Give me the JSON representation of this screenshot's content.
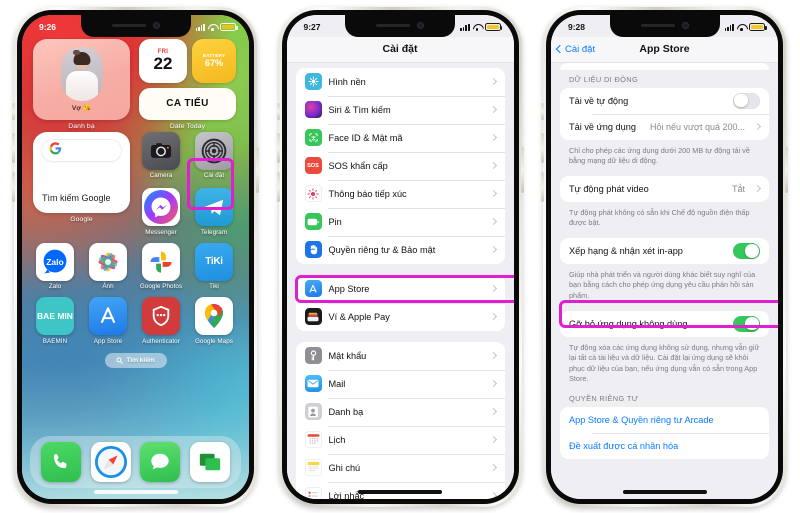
{
  "phone1": {
    "status": {
      "time": "9:26",
      "battery_level": "67",
      "battery_color": "#f5c518"
    },
    "widgets": {
      "contacts": {
        "name": "Vợ 😘",
        "label": "Danh bạ"
      },
      "date": {
        "dow": "FRI",
        "day": "22",
        "battery_title": "BATTERY",
        "battery_value": "67%",
        "ca_text": "CA TIẾU",
        "label": "Date Today"
      },
      "google": {
        "logo": "G",
        "text": "Tìm kiếm Google",
        "label": "Google"
      }
    },
    "apps_row1": [
      {
        "name": "camera-app",
        "label": "Camera"
      },
      {
        "name": "settings-app",
        "label": "Cài đặt"
      }
    ],
    "apps_row2": [
      {
        "name": "messenger-app",
        "label": "Messenger"
      },
      {
        "name": "telegram-app",
        "label": "Telegram"
      }
    ],
    "apps_row3": [
      {
        "name": "zalo-app",
        "label": "Zalo",
        "glyph": "Zalo"
      },
      {
        "name": "photos-app",
        "label": "Ảnh",
        "glyph": ""
      },
      {
        "name": "google-photos-app",
        "label": "Google Photos",
        "glyph": ""
      },
      {
        "name": "tiki-app",
        "label": "Tiki",
        "glyph": "TiKi"
      }
    ],
    "apps_row4": [
      {
        "name": "baemin-app",
        "label": "BAEMIN",
        "glyph": "BAE MIN"
      },
      {
        "name": "app-store-app",
        "label": "App Store",
        "glyph": ""
      },
      {
        "name": "authenticator-app",
        "label": "Authenticator",
        "glyph": ""
      },
      {
        "name": "google-maps-app",
        "label": "Google Maps",
        "glyph": ""
      }
    ],
    "search": "Tìm kiếm",
    "dock": [
      {
        "name": "phone-app",
        "label": "Phone"
      },
      {
        "name": "safari-app",
        "label": "Safari"
      },
      {
        "name": "messages-app",
        "label": "Messages"
      },
      {
        "name": "imessage-app",
        "label": "Messages Green"
      }
    ],
    "highlight_color": "#e020d0"
  },
  "phone2": {
    "status": {
      "time": "9:27",
      "battery_level": "67",
      "battery_color": "#f5c518"
    },
    "nav": {
      "title": "Cài đặt"
    },
    "group1": [
      {
        "label": "Hình nền",
        "icon": "wallpaper-icon",
        "color": "#3fb8e0"
      },
      {
        "label": "Siri & Tìm kiếm",
        "icon": "siri-icon",
        "color": "#1f1f28"
      },
      {
        "label": "Face ID & Mật mã",
        "icon": "faceid-icon",
        "color": "#35c759"
      },
      {
        "label": "SOS khẩn cấp",
        "icon": "sos-icon",
        "color": "#eb4b3c"
      },
      {
        "label": "Thông báo tiếp xúc",
        "icon": "exposure-icon",
        "color": "#ffffff"
      },
      {
        "label": "Pin",
        "icon": "battery-icon",
        "color": "#35c759"
      },
      {
        "label": "Quyền riêng tư & Bảo mật",
        "icon": "hand-icon",
        "color": "#1d74e8"
      }
    ],
    "group2": [
      {
        "label": "App Store",
        "icon": "appstore-icon",
        "color": "#1d88f3",
        "highlighted": true
      },
      {
        "label": "Ví & Apple Pay",
        "icon": "wallet-icon",
        "color": "#1a1a1a",
        "highlighted": false
      }
    ],
    "group3": [
      {
        "label": "Mật khẩu",
        "icon": "passwords-icon",
        "color": "#8e8e93"
      },
      {
        "label": "Mail",
        "icon": "mail-icon",
        "color": "#2e9bf0"
      },
      {
        "label": "Danh bạ",
        "icon": "contacts-icon",
        "color": "#b9b9bf"
      },
      {
        "label": "Lịch",
        "icon": "calendar-icon",
        "color": "#ffffff"
      },
      {
        "label": "Ghi chú",
        "icon": "notes-icon",
        "color": "#f6d44a"
      },
      {
        "label": "Lời nhắc",
        "icon": "reminders-icon",
        "color": "#ffffff"
      }
    ],
    "highlight_color": "#e020d0"
  },
  "phone3": {
    "status": {
      "time": "9:28",
      "battery_level": "67",
      "battery_color": "#f5c518"
    },
    "nav": {
      "back": "Cài đặt",
      "title": "App Store"
    },
    "section1": {
      "header": "DỮ LIỆU DI ĐỘNG",
      "rows": [
        {
          "label": "Tải về tự động",
          "type": "toggle",
          "state": "off"
        },
        {
          "label": "Tải về ứng dụng",
          "type": "value",
          "value": "Hỏi nếu vượt quá 200..."
        }
      ],
      "footnote": "Chỉ cho phép các ứng dụng dưới 200 MB tự động tải về bằng mạng dữ liệu di động."
    },
    "section2": {
      "rows": [
        {
          "label": "Tự động phát video",
          "type": "value",
          "value": "Tắt"
        }
      ],
      "footnote": "Tự động phát không có sẵn khi Chế độ nguồn điện thấp được bật."
    },
    "section3": {
      "rows": [
        {
          "label": "Xếp hạng & nhận xét in-app",
          "type": "toggle",
          "state": "on"
        }
      ],
      "footnote": "Giúp nhà phát triển và người dùng khác biết suy nghĩ của bạn bằng cách cho phép ứng dụng yêu cầu phản hồi sản phẩm."
    },
    "section4": {
      "rows": [
        {
          "label": "Gỡ bỏ ứng dụng không dùng",
          "type": "toggle",
          "state": "on",
          "highlighted": true
        }
      ],
      "footnote": "Tự động xóa các ứng dụng không sử dụng, nhưng vẫn giữ lại tất cả tài liệu và dữ liệu. Cài đặt lại ứng dụng sẽ khôi phục dữ liệu của bạn, nếu ứng dụng vẫn có sẵn trong App Store."
    },
    "section5": {
      "header": "QUYỀN RIÊNG TƯ",
      "rows": [
        {
          "label": "App Store & Quyền riêng tư Arcade",
          "type": "link"
        },
        {
          "label": "Đề xuất được cá nhân hóa",
          "type": "link"
        }
      ]
    },
    "highlight_color": "#e020d0"
  }
}
